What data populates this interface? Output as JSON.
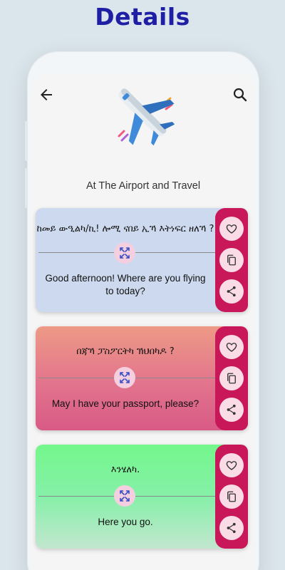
{
  "header": {
    "title": "Details"
  },
  "screen": {
    "subtitle": "At The Airport and Travel",
    "icons": {
      "back": "arrow-left-icon",
      "search": "search-icon",
      "hero": "airplane-icon"
    }
  },
  "cards": [
    {
      "native": "ከመይ ውዒልካ/ኪ! ሎሚ ናበይ ኢኻ እትነፍር ዘለኻ ?",
      "english": "Good afternoon! Where are you flying to today?",
      "background": "#cdd9ee"
    },
    {
      "native": "በጃኻ ፓስፖርትካ ኽህበካዶ ?",
      "english": "May I have your passport, please?",
      "background": "#e2748d"
    },
    {
      "native": "እንሄለካ.",
      "english": "Here you go.",
      "background": "#86f0a8"
    }
  ],
  "actions": {
    "favorite": "heart-icon",
    "copy": "copy-icon",
    "share": "share-icon",
    "swap": "swap-icon"
  },
  "colors": {
    "title": "#1f1fa6",
    "action_bar": "#c8185a",
    "action_button": "#f9dce6"
  }
}
